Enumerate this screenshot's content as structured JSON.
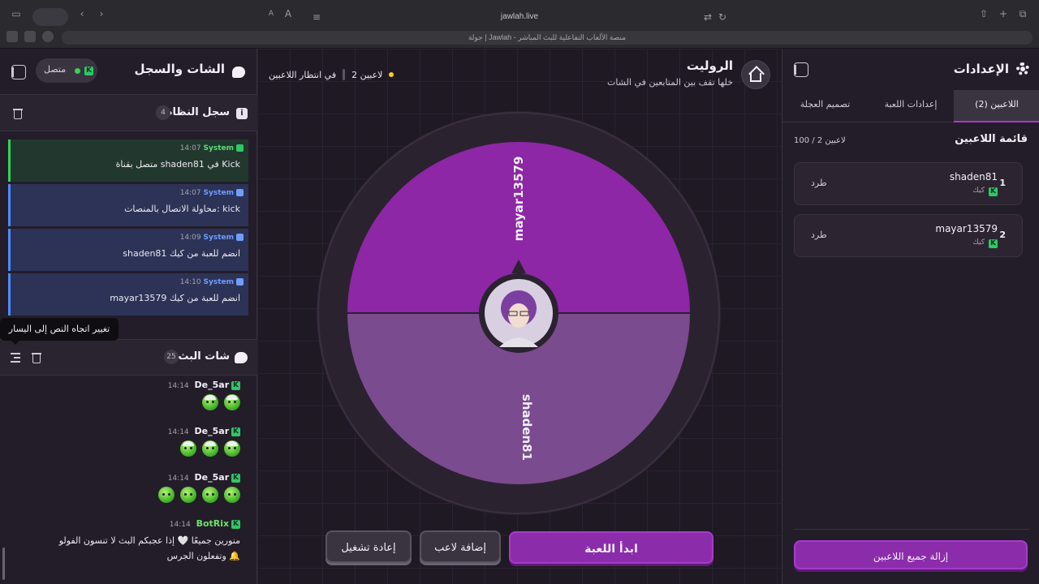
{
  "browser": {
    "url": "jawlah.live",
    "tab_title": "جولة | Jawlah - منصة الألعاب التفاعلية للبث المباشر"
  },
  "chat_panel": {
    "title": "الشات والسجل",
    "connection_status": "متصل",
    "system_log": {
      "title": "سجل النظام",
      "count": "4",
      "messages": [
        {
          "sender": "System",
          "time": "14:07",
          "text": "متصل بقناة shaden81 في Kick",
          "kind": "success"
        },
        {
          "sender": "System",
          "time": "14:07",
          "text": "محاولة الاتصال بالمنصات: kick",
          "kind": "info"
        },
        {
          "sender": "System",
          "time": "14:09",
          "text": "shaden81 انضم للعبة من كيك",
          "kind": "info"
        },
        {
          "sender": "System",
          "time": "14:10",
          "text": "mayar13579 انضم للعبة من كيك",
          "kind": "info"
        }
      ]
    },
    "tooltip": "تغيير اتجاه النص إلى اليسار",
    "stream_chat": {
      "title": "شات البث",
      "count": "25",
      "messages": [
        {
          "user": "De_5ar",
          "time": "14:14",
          "emotes": 2,
          "text": ""
        },
        {
          "user": "De_5ar",
          "time": "14:14",
          "emotes": 3,
          "text": ""
        },
        {
          "user": "De_5ar",
          "time": "14:14",
          "emotes": 4,
          "text": ""
        },
        {
          "user": "BotRix",
          "time": "14:14",
          "emotes": 0,
          "text_line1": "منورين جميعًا 🤍 إذا عجبكم البث لا تنسون الفولو",
          "text_line2": "وتفعلون الجرس 🔔"
        }
      ]
    }
  },
  "game": {
    "title": "الروليت",
    "subtitle": "خلها تقف بين المتابعين في الشات",
    "status_waiting": "في انتظار اللاعبين",
    "status_players": "2 لاعبين",
    "wheel_segments": [
      {
        "label": "mayar13579",
        "color": "#8d27a6"
      },
      {
        "label": "shaden81",
        "color": "#7a4b8e"
      }
    ],
    "buttons": {
      "start": "ابدأ اللعبة",
      "add_player": "إضافة لاعب",
      "restart": "إعادة تشغيل"
    }
  },
  "settings_panel": {
    "title": "الإعدادات",
    "tabs": [
      "اللاعبين (2)",
      "إعدادات اللعبة",
      "تصميم العجلة"
    ],
    "players_list_title": "قائمة اللاعبين",
    "players_count": "100 / 2 لاعبين",
    "players": [
      {
        "num": "1",
        "name": "shaden81",
        "platform": "كيك",
        "action": "طرد"
      },
      {
        "num": "2",
        "name": "mayar13579",
        "platform": "كيك",
        "action": "طرد"
      }
    ],
    "remove_all": "إزالة جميع اللاعبين"
  }
}
